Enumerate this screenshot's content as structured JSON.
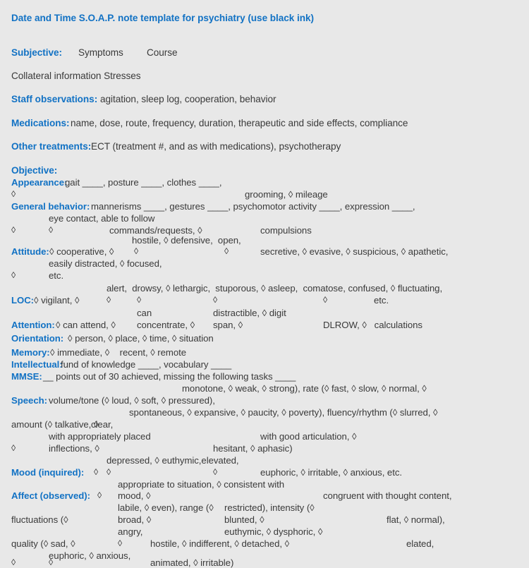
{
  "document": {
    "title": "Date and Time S.O.A.P. note template for psychiatry (use black ink)",
    "accent_color": "#1272c4",
    "text_color": "#3a3a3a",
    "background_color": "#e8e8e8"
  },
  "subjective": {
    "heading": "Subjective:",
    "symptoms": "Symptoms",
    "course": "Course",
    "collateral": "Collateral information Stresses",
    "staff_heading": "Staff observations:",
    "staff_body": "agitation, sleep log, cooperation, behavior",
    "medications_heading": "Medications:",
    "medications_body": "name, dose, route, frequency, duration, therapeutic and side effects, compliance",
    "other_treatments_heading": "Other treatments:",
    "other_treatments_body": "ECT (treatment #, and as with medications), psychotherapy"
  },
  "objective": {
    "heading": "Objective:",
    "appearance": {
      "heading": "Appearance:",
      "line1": "gait ____, posture ____, clothes ____,",
      "diamond_left": "◊",
      "line2": "grooming, ◊ mileage"
    },
    "general_behavior": {
      "heading": "General behavior:",
      "line1": "mannerisms ____, gestures ____, psychomotor activity ____, expression ____,",
      "line2": "eye contact, able to follow",
      "diamond_a": "◊",
      "diamond_b": "◊",
      "line3": "commands/requests, ◊",
      "line4": "compulsions",
      "line5": "hostile, ◊ defensive,  open,"
    },
    "attitude": {
      "heading": "Attitude:",
      "line1": "◊ cooperative, ◊",
      "diamond_a": "◊",
      "diamond_b": "◊",
      "line2": "secretive, ◊ evasive, ◊ suspicious, ◊ apathetic,",
      "line3": "easily distracted, ◊ focused,",
      "diamond_c": "◊",
      "line4": "etc."
    },
    "loc": {
      "heading": "LOC:",
      "top": "alert,  drowsy, ◊ lethargic,  stuporous, ◊ asleep,  comatose, confused, ◊ fluctuating,",
      "line1": "◊ vigilant, ◊",
      "diamond_a": "◊",
      "diamond_b": "◊",
      "diamond_c": "◊",
      "diamond_d": "◊",
      "etc": "etc."
    },
    "attention": {
      "heading": "Attention:",
      "top_a": "can",
      "top_b": "distractible, ◊ digit",
      "line1": "◊ can attend, ◊",
      "line2": "concentrate, ◊",
      "line3": "span, ◊",
      "line4": "DLROW, ◊   calculations"
    },
    "orientation": {
      "heading": "Orientation:",
      "body": "◊ person, ◊ place, ◊ time, ◊ situation"
    },
    "memory": {
      "heading": "Memory:",
      "body": "◊ immediate, ◊    recent, ◊ remote"
    },
    "intellectual": {
      "heading": "Intellectual:",
      "body": "fund of knowledge ____, vocabulary ____"
    },
    "mmse": {
      "heading": "MMSE:",
      "body": "__ points out of 30 achieved, missing the following tasks ____"
    },
    "speech": {
      "heading": "Speech:",
      "top": "monotone, ◊ weak, ◊ strong), rate (◊ fast, ◊ slow, ◊ normal, ◊",
      "line1": "volume/tone (◊ loud, ◊ soft, ◊ pressured),",
      "line2": "spontaneous, ◊ expansive, ◊ paucity, ◊ poverty), fluency/rhythm (◊ slurred, ◊",
      "line3": "amount (◊ talkative, ◊",
      "line4": "clear,",
      "line5": "with appropriately placed",
      "line6": "with good articulation, ◊",
      "diamond_a": "◊",
      "line7": "inflections, ◊",
      "line8": "hesitant, ◊ aphasic)"
    },
    "mood": {
      "heading": "Mood (inquired):",
      "top": "depressed, ◊ euthymic,elevated,",
      "line1": "◊",
      "diamond_a": "◊",
      "diamond_b": "◊",
      "line2": "euphoric, ◊ irritable, ◊ anxious, etc.",
      "line3": "appropriate to situation, ◊ consistent with"
    },
    "affect": {
      "heading": "Affect (observed):",
      "line1": "◊",
      "line2": "mood, ◊",
      "line3": "congruent with thought content,",
      "line4": "labile, ◊ even), range (◊",
      "line5": "restricted), intensity (◊",
      "line6": "fluctuations (◊",
      "line7": "broad, ◊",
      "line8": "blunted, ◊",
      "line9": "flat, ◊ normal),",
      "line10": "angry,",
      "line11": "euthymic, ◊ dysphoric, ◊",
      "line12": "quality (◊ sad, ◊",
      "diamond_a": "◊",
      "line13": "hostile, ◊ indifferent, ◊ detached, ◊",
      "line14": "elated,",
      "line15": "euphoric, ◊ anxious,",
      "diamond_b": "◊",
      "diamond_c": "◊",
      "line16": "animated, ◊ irritable)"
    }
  }
}
